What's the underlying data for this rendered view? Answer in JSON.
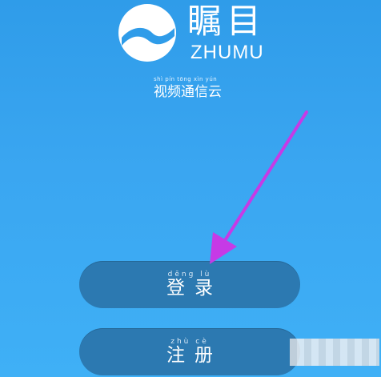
{
  "app": {
    "brand_name": "瞩目",
    "brand_en": "ZHUMU",
    "tagline": "视频通信云",
    "tagline_pinyin": "shì pín tōng xìn yún"
  },
  "buttons": {
    "login_label": "登录",
    "login_pinyin": "dēng   lù",
    "register_label": "注册",
    "register_pinyin": "zhù   cè"
  },
  "colors": {
    "background": "#3aa6f1",
    "button_fill": "#2c79b1",
    "annotation_arrow": "#c63ae6"
  },
  "icons": {
    "logo": "zhumu-wave-logo",
    "annotation": "arrow-annotation"
  }
}
